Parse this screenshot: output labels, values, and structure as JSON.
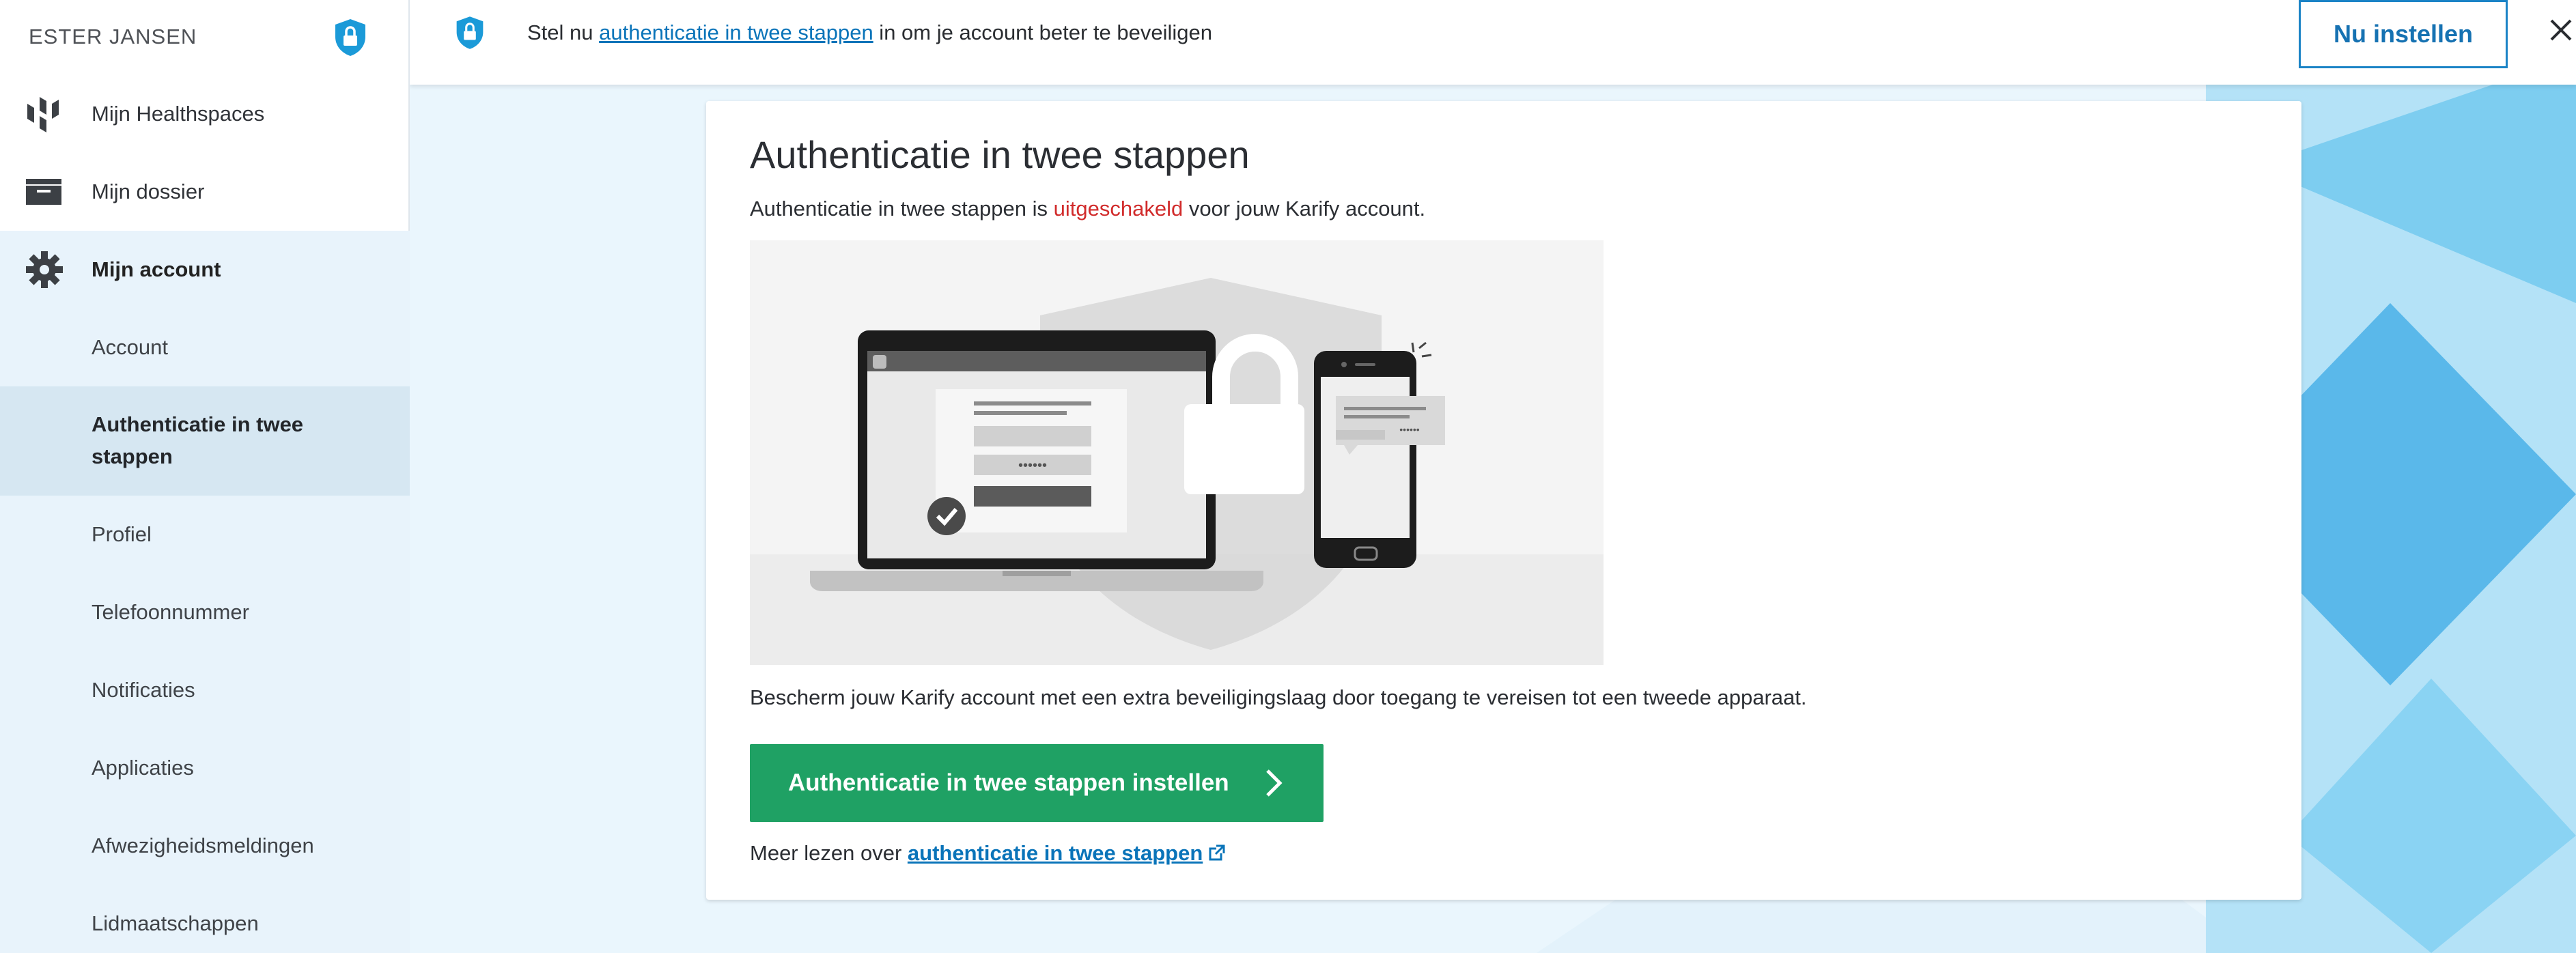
{
  "user": {
    "name": "ESTER JANSEN"
  },
  "nav": {
    "healthspaces": "Mijn Healthspaces",
    "dossier": "Mijn dossier",
    "account": "Mijn account",
    "sub_items": [
      "Account",
      "Authenticatie in twee stappen",
      "Profiel",
      "Telefoonnummer",
      "Notificaties",
      "Applicaties",
      "Afwezigheidsmeldingen",
      "Lidmaatschappen"
    ]
  },
  "banner": {
    "prefix": "Stel nu ",
    "link": "authenticatie in twee stappen",
    "suffix": " in om je account beter te beveiligen",
    "button": "Nu instellen"
  },
  "card": {
    "title": "Authenticatie in twee stappen",
    "status_prefix": "Authenticatie in twee stappen is ",
    "status_value": "uitgeschakeld",
    "status_suffix": " voor jouw Karify account.",
    "description": "Bescherm jouw Karify account met een extra beveiligingslaag door toegang te vereisen tot een tweede apparaat.",
    "button": "Authenticatie in twee stappen instellen",
    "more_prefix": "Meer lezen over ",
    "more_link": "authenticatie in twee stappen"
  },
  "illustration": {
    "password_dots": "••••••"
  },
  "icons": {
    "user_shield": "shield-lock-icon",
    "healthspaces": "healthspaces-icon",
    "dossier": "folder-icon",
    "account": "gear-icon",
    "banner_shield": "shield-lock-icon",
    "close": "close-icon",
    "chevron": "chevron-right-icon",
    "external": "external-link-icon"
  },
  "colors": {
    "accent": "#1b83c6",
    "link": "#0a74b9",
    "danger": "#d12b2b",
    "primary_button": "#1fa164",
    "sidebar_group_bg": "#e8f3fb",
    "selected_bg": "#d6e7f2"
  }
}
